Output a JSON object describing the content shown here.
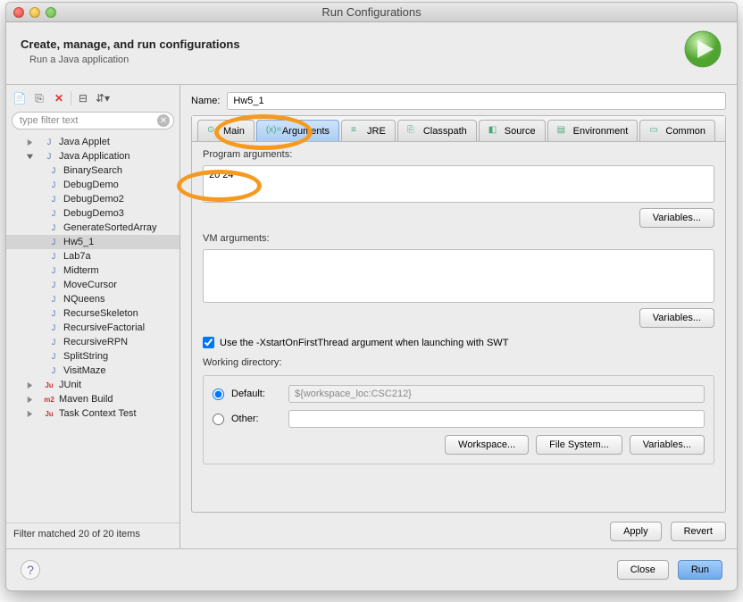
{
  "window": {
    "title": "Run Configurations"
  },
  "header": {
    "title": "Create, manage, and run configurations",
    "subtitle": "Run a Java application"
  },
  "sidebar": {
    "filter_placeholder": "type filter text",
    "status": "Filter matched 20 of 20 items",
    "nodes": [
      {
        "label": "Java Applet",
        "icon": "j",
        "level": 1
      },
      {
        "label": "Java Application",
        "icon": "j",
        "level": 1,
        "expanded": true
      },
      {
        "label": "BinarySearch",
        "icon": "j",
        "level": 2
      },
      {
        "label": "DebugDemo",
        "icon": "j",
        "level": 2
      },
      {
        "label": "DebugDemo2",
        "icon": "j",
        "level": 2
      },
      {
        "label": "DebugDemo3",
        "icon": "j",
        "level": 2
      },
      {
        "label": "GenerateSortedArray",
        "icon": "j",
        "level": 2
      },
      {
        "label": "Hw5_1",
        "icon": "j",
        "level": 2,
        "selected": true
      },
      {
        "label": "Lab7a",
        "icon": "j",
        "level": 2
      },
      {
        "label": "Midterm",
        "icon": "j",
        "level": 2
      },
      {
        "label": "MoveCursor",
        "icon": "j",
        "level": 2
      },
      {
        "label": "NQueens",
        "icon": "j",
        "level": 2
      },
      {
        "label": "RecurseSkeleton",
        "icon": "j",
        "level": 2
      },
      {
        "label": "RecursiveFactorial",
        "icon": "j",
        "level": 2
      },
      {
        "label": "RecursiveRPN",
        "icon": "j",
        "level": 2
      },
      {
        "label": "SplitString",
        "icon": "j",
        "level": 2
      },
      {
        "label": "VisitMaze",
        "icon": "j",
        "level": 2
      },
      {
        "label": "JUnit",
        "icon": "ju",
        "level": 1
      },
      {
        "label": "Maven Build",
        "icon": "m2",
        "level": 1
      },
      {
        "label": "Task Context Test",
        "icon": "ju",
        "level": 1
      }
    ]
  },
  "main": {
    "name_label": "Name:",
    "name_value": "Hw5_1",
    "tabs": [
      {
        "label": "Main"
      },
      {
        "label": "Arguments",
        "active": true
      },
      {
        "label": "JRE"
      },
      {
        "label": "Classpath"
      },
      {
        "label": "Source"
      },
      {
        "label": "Environment"
      },
      {
        "label": "Common"
      }
    ],
    "program_args_label": "Program arguments:",
    "program_args_value": "20 24",
    "variables_label": "Variables...",
    "vm_args_label": "VM arguments:",
    "vm_args_value": "",
    "swt_check_label": "Use the -XstartOnFirstThread argument when launching with SWT",
    "swt_checked": true,
    "workdir_label": "Working directory:",
    "default_label": "Default:",
    "other_label": "Other:",
    "default_value": "${workspace_loc:CSC212}",
    "other_value": "",
    "workspace_btn": "Workspace...",
    "filesystem_btn": "File System...",
    "apply_label": "Apply",
    "revert_label": "Revert"
  },
  "footer": {
    "close": "Close",
    "run": "Run"
  }
}
